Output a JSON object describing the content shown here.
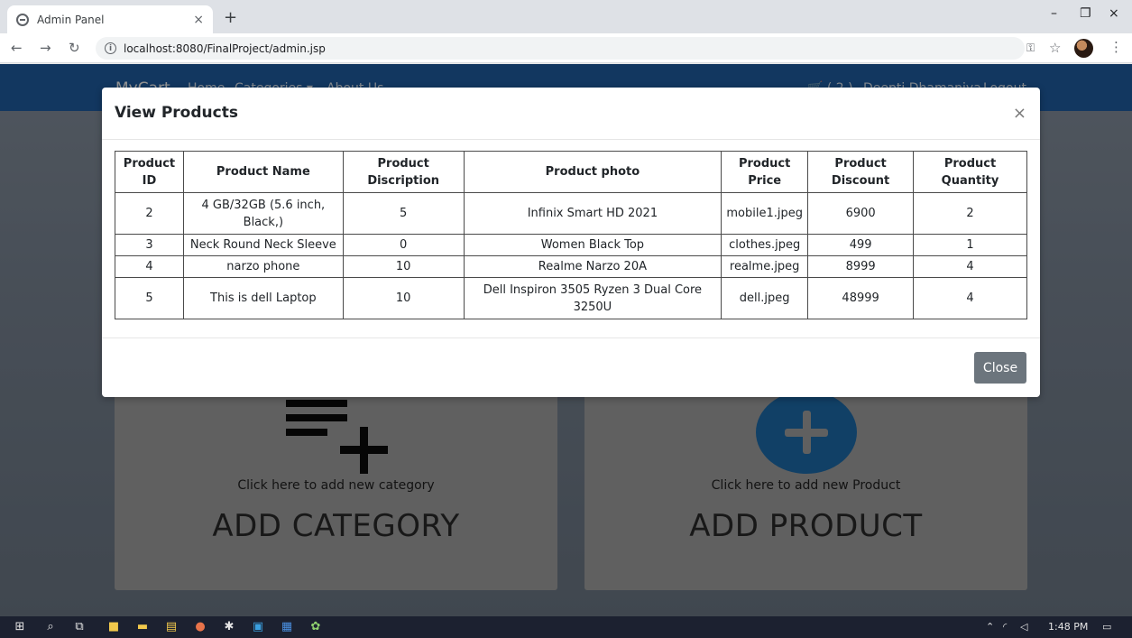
{
  "browser": {
    "tab_title": "Admin Panel",
    "tab_close": "×",
    "new_tab": "+",
    "url": "localhost:8080/FinalProject/admin.jsp",
    "window_controls": [
      "–",
      "❐",
      "×"
    ]
  },
  "app_nav": {
    "brand": "MyCart",
    "links": [
      "Home",
      "Categories ▾",
      "About Us"
    ],
    "cart": "🛒 ( 2 )",
    "user": "Deepti Dhamaniya",
    "logout": "Logout"
  },
  "cards": {
    "category": {
      "text": "Click here to add new category",
      "title": "ADD CATEGORY"
    },
    "product": {
      "text": "Click here to add new Product",
      "title": "ADD PRODUCT"
    }
  },
  "modal": {
    "title": "View Products",
    "close_x": "×",
    "close_button": "Close",
    "headers": [
      "Product ID",
      "Product Name",
      "Product Discription",
      "Product photo",
      "Product Price",
      "Product Discount",
      "Product Quantity"
    ],
    "rows": [
      [
        "2",
        "4 GB/32GB (5.6 inch, Black,)",
        "5",
        "Infinix Smart HD 2021",
        "mobile1.jpeg",
        "6900",
        "2"
      ],
      [
        "3",
        "Neck Round Neck Sleeve",
        "0",
        "Women Black Top",
        "clothes.jpeg",
        "499",
        "1"
      ],
      [
        "4",
        "narzo phone",
        "10",
        "Realme Narzo 20A",
        "realme.jpeg",
        "8999",
        "4"
      ],
      [
        "5",
        "This is dell Laptop",
        "10",
        "Dell Inspiron 3505 Ryzen 3 Dual Core 3250U",
        "dell.jpeg",
        "48999",
        "4"
      ]
    ]
  },
  "taskbar": {
    "time": "1:48 PM"
  },
  "colors": {
    "navbar": "#1f5fa6",
    "close_button": "#6c757d",
    "product_icon": "#1e6fb0"
  }
}
